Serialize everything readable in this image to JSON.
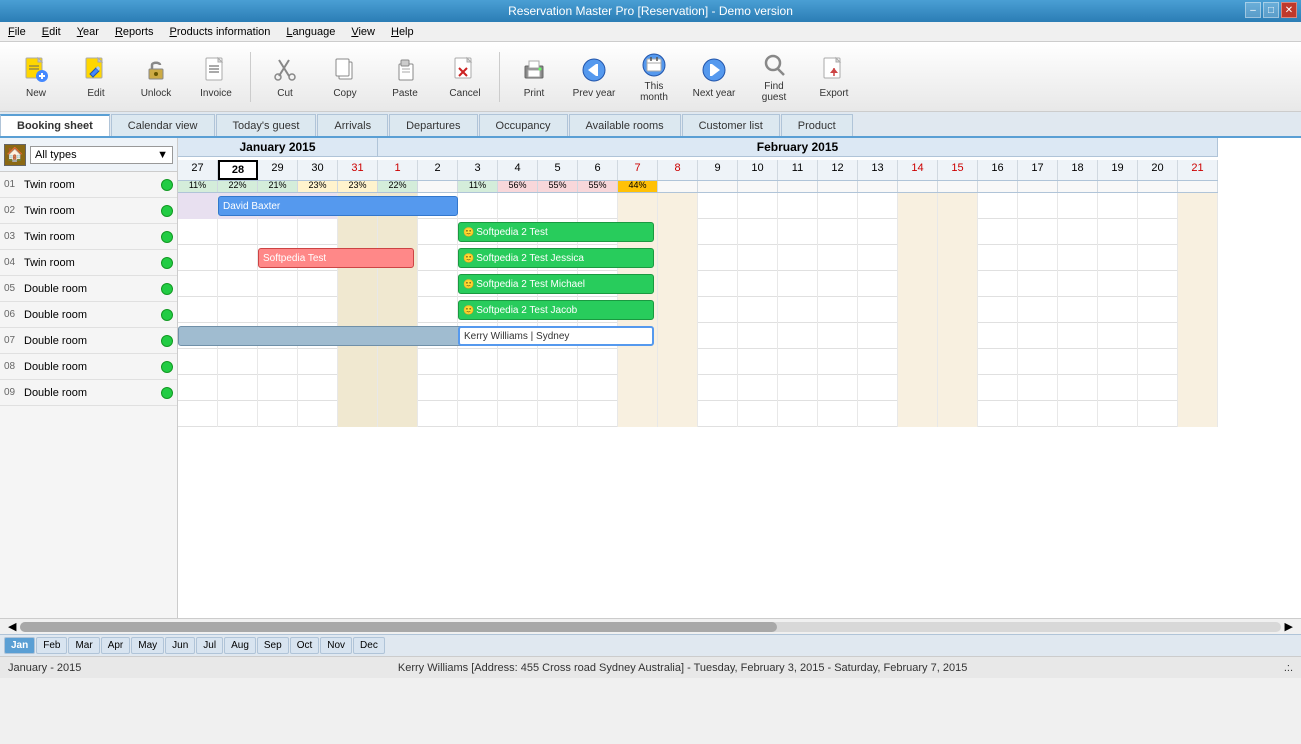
{
  "app": {
    "title": "Reservation Master Pro [Reservation] - Demo version",
    "icon": "🏨"
  },
  "window_controls": {
    "minimize": "–",
    "maximize": "□",
    "close": "✕"
  },
  "menu": {
    "items": [
      "File",
      "Edit",
      "Year",
      "Reports",
      "Products information",
      "Language",
      "View",
      "Help"
    ]
  },
  "toolbar": {
    "buttons": [
      {
        "id": "new",
        "label": "New",
        "icon": "✦"
      },
      {
        "id": "edit",
        "label": "Edit",
        "icon": "✏"
      },
      {
        "id": "unlock",
        "label": "Unlock",
        "icon": "🔓"
      },
      {
        "id": "invoice",
        "label": "Invoice",
        "icon": "📄"
      },
      {
        "id": "cut",
        "label": "Cut",
        "icon": "✂"
      },
      {
        "id": "copy",
        "label": "Copy",
        "icon": "📋"
      },
      {
        "id": "paste",
        "label": "Paste",
        "icon": "📌"
      },
      {
        "id": "cancel",
        "label": "Cancel",
        "icon": "✖"
      },
      {
        "id": "print",
        "label": "Print",
        "icon": "🖨"
      },
      {
        "id": "prev-year",
        "label": "Prev year",
        "icon": "◀◀"
      },
      {
        "id": "this-month",
        "label": "This\nmonth",
        "icon": "📅"
      },
      {
        "id": "next-year",
        "label": "Next year",
        "icon": "▶▶"
      },
      {
        "id": "find-guest",
        "label": "Find\nguest",
        "icon": "🔍"
      },
      {
        "id": "export",
        "label": "Export",
        "icon": "📤"
      }
    ]
  },
  "tabs": {
    "items": [
      {
        "id": "booking-sheet",
        "label": "Booking sheet",
        "active": true
      },
      {
        "id": "calendar-view",
        "label": "Calendar view"
      },
      {
        "id": "todays-guest",
        "label": "Today's guest"
      },
      {
        "id": "arrivals",
        "label": "Arrivals"
      },
      {
        "id": "departures",
        "label": "Departures"
      },
      {
        "id": "occupancy",
        "label": "Occupancy"
      },
      {
        "id": "available-rooms",
        "label": "Available rooms"
      },
      {
        "id": "customer-list",
        "label": "Customer list"
      },
      {
        "id": "product",
        "label": "Product"
      }
    ]
  },
  "sidebar": {
    "type_label": "All types",
    "rooms": [
      {
        "num": "01",
        "name": "Twin room",
        "status": "green"
      },
      {
        "num": "02",
        "name": "Twin room",
        "status": "green"
      },
      {
        "num": "03",
        "name": "Twin room",
        "status": "green"
      },
      {
        "num": "04",
        "name": "Twin room",
        "status": "green"
      },
      {
        "num": "05",
        "name": "Double room",
        "status": "green"
      },
      {
        "num": "06",
        "name": "Double room",
        "status": "green"
      },
      {
        "num": "07",
        "name": "Double room",
        "status": "green"
      },
      {
        "num": "08",
        "name": "Double room",
        "status": "green"
      },
      {
        "num": "09",
        "name": "Double room",
        "status": "green"
      }
    ]
  },
  "calendar": {
    "months": [
      {
        "name": "January 2015",
        "days": 4
      },
      {
        "name": "February 2015",
        "days": 21
      }
    ],
    "jan_days": [
      27,
      28,
      29,
      30,
      31
    ],
    "feb_days": [
      1,
      2,
      3,
      4,
      5,
      6,
      7,
      8,
      9,
      10,
      11,
      12,
      13,
      14,
      15,
      16,
      17,
      18,
      19,
      20,
      21
    ],
    "jan_weekend_days": [
      31
    ],
    "feb_weekend_days": [
      1,
      7,
      8,
      14,
      15,
      21
    ],
    "today": 28,
    "occupancy": [
      {
        "day": 27,
        "val": "11%",
        "type": "low"
      },
      {
        "day": 28,
        "val": "22%",
        "type": "low"
      },
      {
        "day": 29,
        "val": "21%",
        "type": "low"
      },
      {
        "day": 30,
        "val": "23%",
        "type": "mid"
      },
      {
        "day": 31,
        "val": "23%",
        "type": "mid"
      },
      {
        "day": "f1",
        "val": "22%",
        "type": "low"
      },
      {
        "day": "f2",
        "val": "",
        "type": ""
      },
      {
        "day": "f3",
        "val": "11%",
        "type": "low"
      },
      {
        "day": "f4",
        "val": "56%",
        "type": "high"
      },
      {
        "day": "f5",
        "val": "55%",
        "type": "high"
      },
      {
        "day": "f6",
        "val": "55%",
        "type": "high"
      },
      {
        "day": "f7",
        "val": "44%",
        "type": "full"
      }
    ],
    "reservations": [
      {
        "id": "david",
        "room": 0,
        "label": "David Baxter",
        "startDay": 28,
        "endDay": 4,
        "color": "blue",
        "startOffset": 1,
        "span": 8
      },
      {
        "id": "softpedia1",
        "room": 1,
        "label": "Softpedia 2 Test",
        "startDay": "f3",
        "endDay": "f7",
        "color": "green",
        "startOffset": 8,
        "span": 5
      },
      {
        "id": "softpedia2",
        "room": 2,
        "label": "Softpedia 2 Test Jessica",
        "startDay": "f3",
        "endDay": "f7",
        "color": "green",
        "startOffset": 8,
        "span": 5
      },
      {
        "id": "softpedia3",
        "room": 2,
        "label": "Softpedia Test",
        "startDay": 29,
        "endDay": "f1",
        "color": "red",
        "startOffset": 2,
        "span": 4
      },
      {
        "id": "softpedia4",
        "room": 3,
        "label": "Softpedia 2 Test Michael",
        "startDay": "f3",
        "endDay": "f7",
        "color": "green",
        "startOffset": 8,
        "span": 5
      },
      {
        "id": "softpedia5",
        "room": 4,
        "label": "Softpedia 2 Test Jacob",
        "startDay": "f3",
        "endDay": "f7",
        "color": "green",
        "startOffset": 8,
        "span": 5
      },
      {
        "id": "kerry",
        "room": 5,
        "label": "Kerry Williams | Sydney",
        "startDay": "f3",
        "endDay": "f7",
        "color": "selected",
        "startOffset": 8,
        "span": 5
      },
      {
        "id": "gray1",
        "room": 5,
        "label": "",
        "startDay": 27,
        "endDay": "f1",
        "color": "gray",
        "startOffset": 0,
        "span": 8
      }
    ]
  },
  "month_tabs": [
    "Jan",
    "Feb",
    "Mar",
    "Apr",
    "May",
    "Jun",
    "Jul",
    "Aug",
    "Sep",
    "Oct",
    "Nov",
    "Dec"
  ],
  "active_month_tab": "Jan",
  "status": {
    "left": "January - 2015",
    "right": "Kerry Williams [Address: 455 Cross road Sydney Australia] - Tuesday, February 3, 2015 - Saturday, February 7, 2015",
    "dots": ".:."
  }
}
